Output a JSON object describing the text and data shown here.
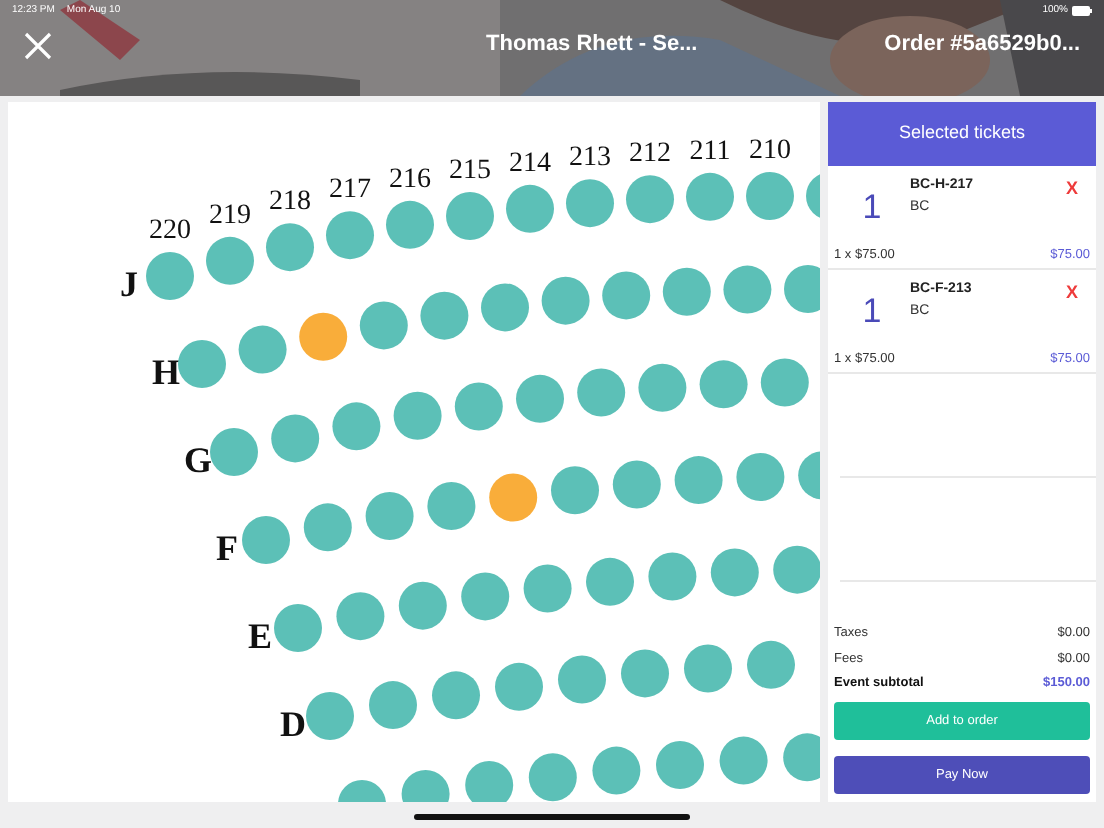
{
  "status_bar": {
    "time": "12:23 PM",
    "date": "Mon Aug 10",
    "battery": "100%"
  },
  "header": {
    "title": "Thomas Rhett - Se...",
    "order": "Order #5a6529b0..."
  },
  "seat_map": {
    "column_labels": [
      "220",
      "219",
      "218",
      "217",
      "216",
      "215",
      "214",
      "213",
      "212",
      "211",
      "210"
    ],
    "rows": [
      {
        "label": "J",
        "seats": [
          {
            "selected": false
          },
          {
            "selected": false
          },
          {
            "selected": false
          },
          {
            "selected": false
          },
          {
            "selected": false
          },
          {
            "selected": false
          },
          {
            "selected": false
          },
          {
            "selected": false
          },
          {
            "selected": false
          },
          {
            "selected": false
          },
          {
            "selected": false
          },
          {
            "selected": false
          }
        ]
      },
      {
        "label": "H",
        "seats": [
          {
            "selected": false
          },
          {
            "selected": false
          },
          {
            "selected": true
          },
          {
            "selected": false
          },
          {
            "selected": false
          },
          {
            "selected": false
          },
          {
            "selected": false
          },
          {
            "selected": false
          },
          {
            "selected": false
          },
          {
            "selected": false
          },
          {
            "selected": false
          }
        ]
      },
      {
        "label": "G",
        "seats": [
          {
            "selected": false
          },
          {
            "selected": false
          },
          {
            "selected": false
          },
          {
            "selected": false
          },
          {
            "selected": false
          },
          {
            "selected": false
          },
          {
            "selected": false
          },
          {
            "selected": false
          },
          {
            "selected": false
          },
          {
            "selected": false
          }
        ]
      },
      {
        "label": "F",
        "seats": [
          {
            "selected": false
          },
          {
            "selected": false
          },
          {
            "selected": false
          },
          {
            "selected": false
          },
          {
            "selected": true
          },
          {
            "selected": false
          },
          {
            "selected": false
          },
          {
            "selected": false
          },
          {
            "selected": false
          },
          {
            "selected": false
          }
        ]
      },
      {
        "label": "E",
        "seats": [
          {
            "selected": false
          },
          {
            "selected": false
          },
          {
            "selected": false
          },
          {
            "selected": false
          },
          {
            "selected": false
          },
          {
            "selected": false
          },
          {
            "selected": false
          },
          {
            "selected": false
          },
          {
            "selected": false
          }
        ]
      },
      {
        "label": "D",
        "seats": [
          {
            "selected": false
          },
          {
            "selected": false
          },
          {
            "selected": false
          },
          {
            "selected": false
          },
          {
            "selected": false
          },
          {
            "selected": false
          },
          {
            "selected": false
          },
          {
            "selected": false
          }
        ]
      },
      {
        "seats": [
          {
            "selected": false
          },
          {
            "selected": false
          },
          {
            "selected": false
          },
          {
            "selected": false
          },
          {
            "selected": false
          },
          {
            "selected": false
          },
          {
            "selected": false
          },
          {
            "selected": false
          }
        ]
      }
    ]
  },
  "cart": {
    "title": "Selected tickets",
    "items": [
      {
        "quantity": "1",
        "code": "BC-H-217",
        "section": "BC",
        "remove": "X",
        "unit_line": "1 x $75.00",
        "total": "$75.00"
      },
      {
        "quantity": "1",
        "code": "BC-F-213",
        "section": "BC",
        "remove": "X",
        "unit_line": "1 x $75.00",
        "total": "$75.00"
      }
    ],
    "summary": [
      {
        "kind": "plain",
        "label": "Taxes",
        "value": "$0.00"
      },
      {
        "kind": "plain",
        "label": "Fees",
        "value": "$0.00"
      },
      {
        "kind": "total",
        "label": "Event subtotal",
        "value": "$150.00"
      }
    ],
    "add_button": "Add to order",
    "pay_button": "Pay Now"
  }
}
